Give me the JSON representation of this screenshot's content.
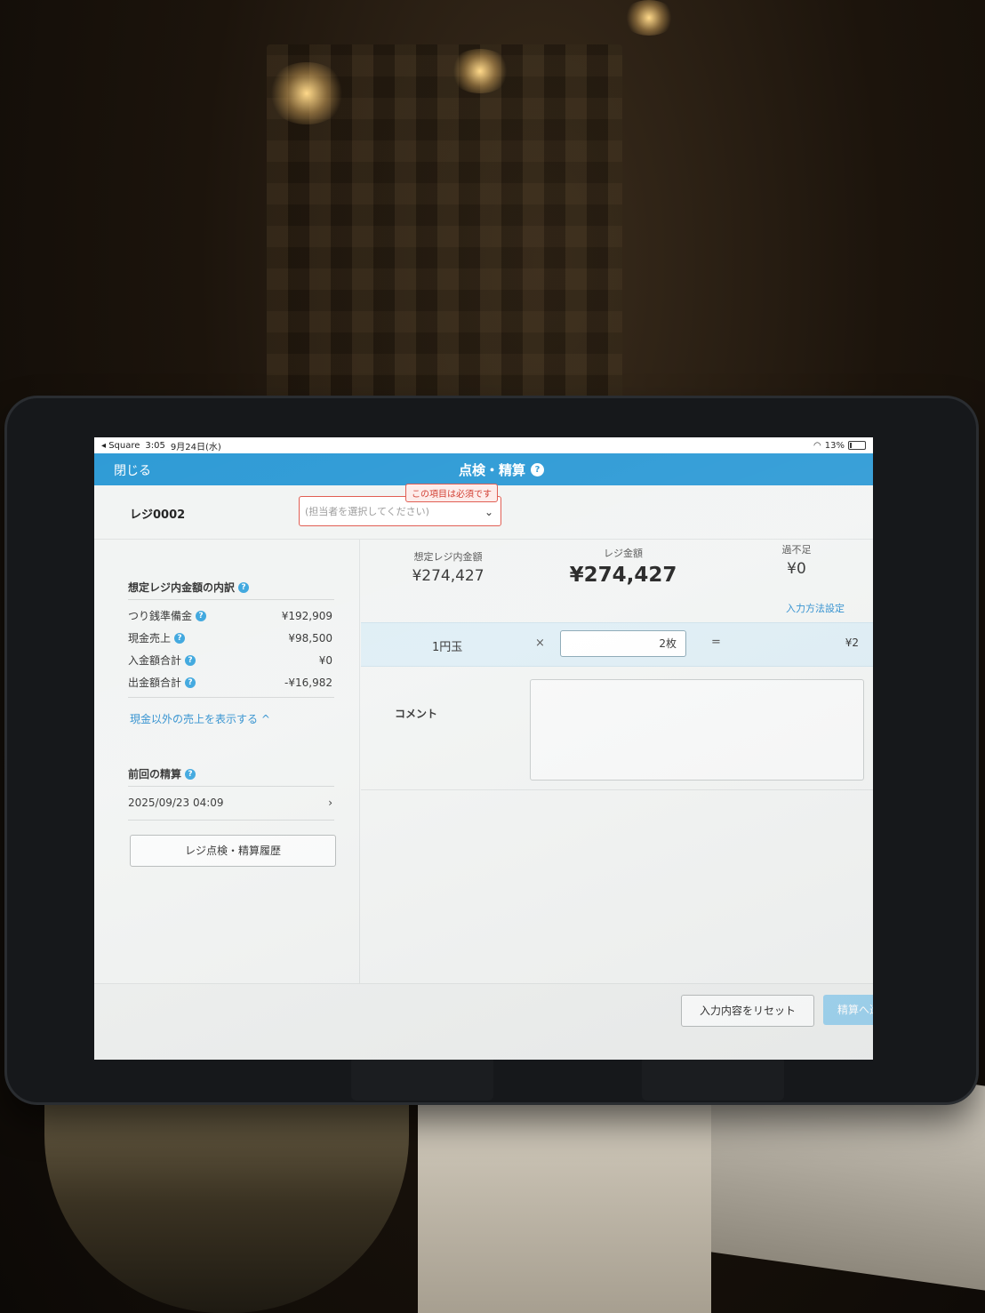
{
  "status_bar": {
    "back_app": "◂ Square",
    "time": "3:05",
    "date": "9月24日(水)",
    "battery": "13%"
  },
  "nav": {
    "close_label": "閉じる",
    "title": "点検・精算",
    "help_glyph": "?"
  },
  "register": {
    "name": "レジ0002",
    "staff_placeholder": "(担当者を選択してください)",
    "required_message": "この項目は必須です"
  },
  "breakdown": {
    "title": "想定レジ内金額の内訳",
    "rows": [
      {
        "label": "つり銭準備金",
        "value": "¥192,909"
      },
      {
        "label": "現金売上",
        "value": "¥98,500"
      },
      {
        "label": "入金額合計",
        "value": "¥0"
      },
      {
        "label": "出金額合計",
        "value": "-¥16,982"
      }
    ],
    "show_non_cash_link": "現金以外の売上を表示する ^"
  },
  "previous": {
    "title": "前回の精算",
    "datetime": "2025/09/23 04:09",
    "history_button": "レジ点検・精算履歴"
  },
  "summary": {
    "expected_label": "想定レジ内金額",
    "expected_value": "¥274,427",
    "register_label": "レジ金額",
    "register_value": "¥274,427",
    "diff_label": "過不足",
    "diff_value": "¥0",
    "input_settings_link": "入力方法設定"
  },
  "coin_row": {
    "denomination": "1円玉",
    "times": "×",
    "quantity": "2枚",
    "equals": "=",
    "subtotal": "¥2"
  },
  "comment": {
    "label": "コメント",
    "value": ""
  },
  "footer": {
    "reset_button": "入力内容をリセット",
    "next_button": "精算へ進む"
  },
  "colors": {
    "nav_blue": "#2f9bd6",
    "error_red": "#e05a4f",
    "link_blue": "#2f8fcf",
    "next_disabled": "#9fd3ef"
  }
}
